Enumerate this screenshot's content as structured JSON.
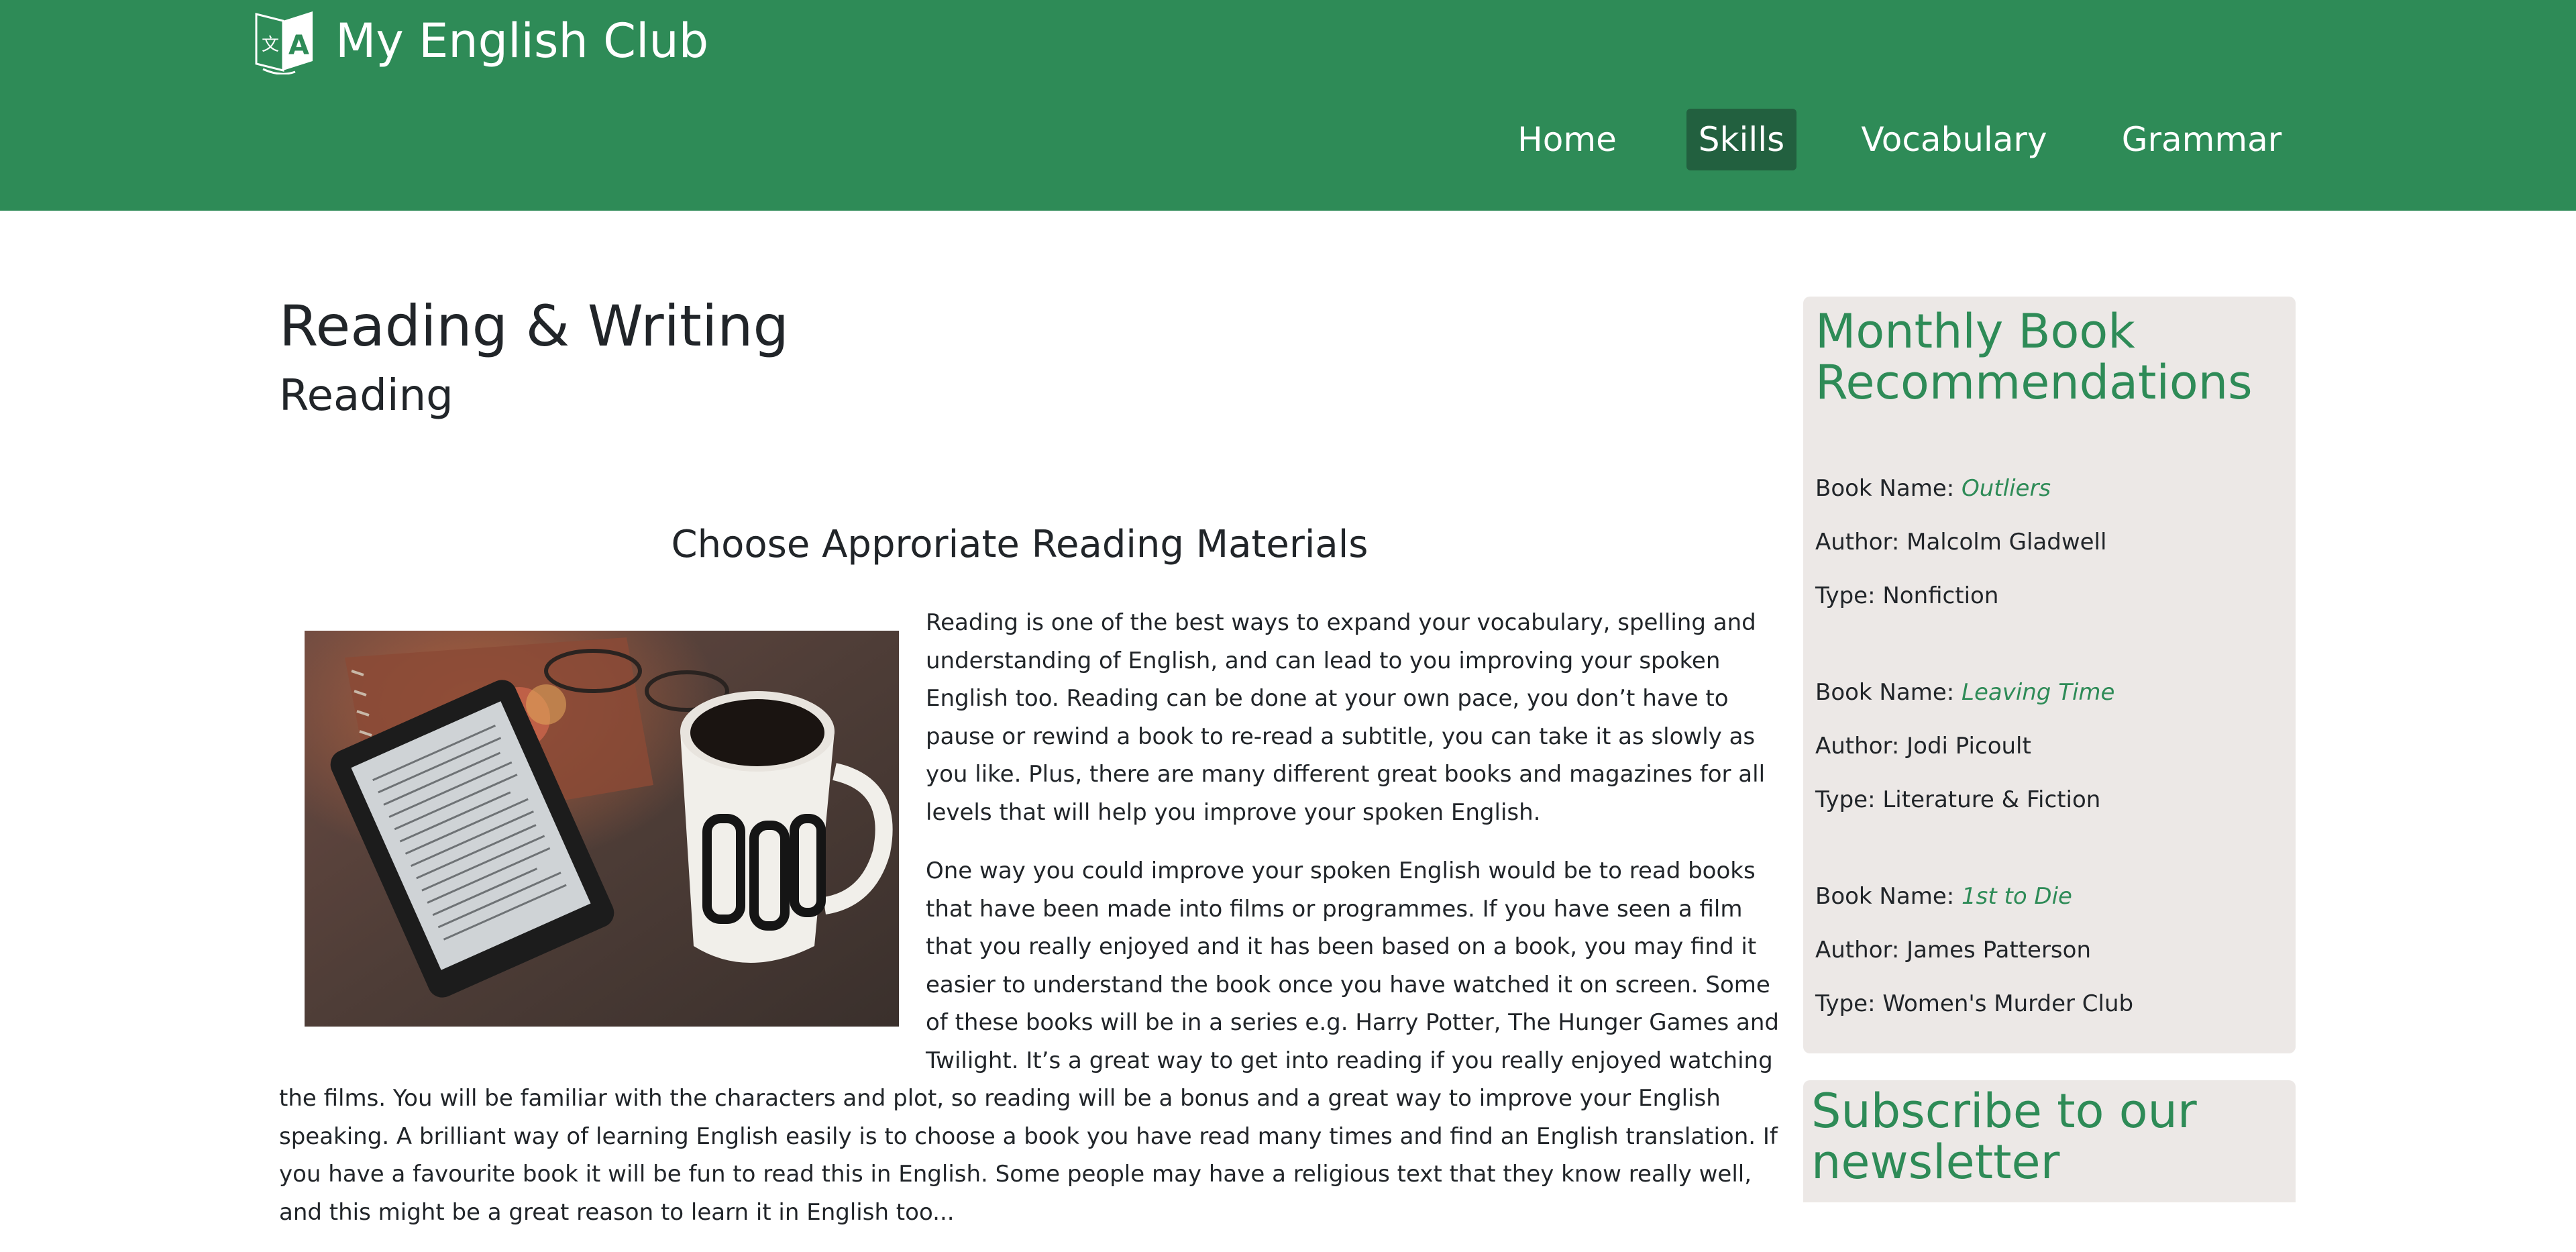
{
  "brand": {
    "title": "My English Club",
    "logo_icon": "translate-book-icon",
    "logo_letters": [
      "文",
      "A"
    ]
  },
  "nav": {
    "items": [
      {
        "label": "Home",
        "active": false
      },
      {
        "label": "Skills",
        "active": true
      },
      {
        "label": "Vocabulary",
        "active": false
      },
      {
        "label": "Grammar",
        "active": false
      }
    ]
  },
  "main": {
    "title": "Reading & Writing",
    "subtitle": "Reading",
    "section_title": "Choose Approriate Reading Materials",
    "image_alt": "e-reader-and-coffee-mug-photo",
    "paragraphs": [
      "Reading is one of the best ways to expand your vocabulary, spelling and understanding of English, and can lead to you improving your spoken English too. Reading can be done at your own pace, you don’t have to pause or rewind a book to re-read a subtitle, you can take it as slowly as you like. Plus, there are many different great books and magazines for all levels that will help you improve your spoken English.",
      "One way you could improve your spoken English would be to read books that have been made into films or programmes. If you have seen a film that you really enjoyed and it has been based on a book, you may find it easier to understand the book once you have watched it on screen. Some of these books will be in a series e.g. Harry Potter, The Hunger Games and Twilight. It’s a great way to get into reading if you really enjoyed watching the films. You will be familiar with the characters and plot, so reading will be a bonus and a great way to improve your English speaking. A brilliant way of learning English easily is to choose a book you have read many times and find an English translation. If you have a favourite book it will be fun to read this in English. Some people may have a religious text that they know really well, and this might be a great reason to learn it in English too..."
    ]
  },
  "sidebar": {
    "recommendations": {
      "title": "Monthly Book Recommendations",
      "name_label": "Book Name: ",
      "author_label": "Author: ",
      "type_label": "Type: ",
      "books": [
        {
          "name": "Outliers",
          "author": "Malcolm Gladwell",
          "type": "Nonfiction"
        },
        {
          "name": "Leaving Time",
          "author": "Jodi Picoult",
          "type": "Literature & Fiction"
        },
        {
          "name": "1st to Die",
          "author": "James Patterson",
          "type": "Women's Murder Club"
        }
      ]
    },
    "newsletter": {
      "title": "Subscribe to our newsletter"
    }
  },
  "colors": {
    "brand_green": "#2e8b57",
    "nav_active": "#22603f",
    "card_bg": "#ece8e6",
    "text": "#212529"
  }
}
